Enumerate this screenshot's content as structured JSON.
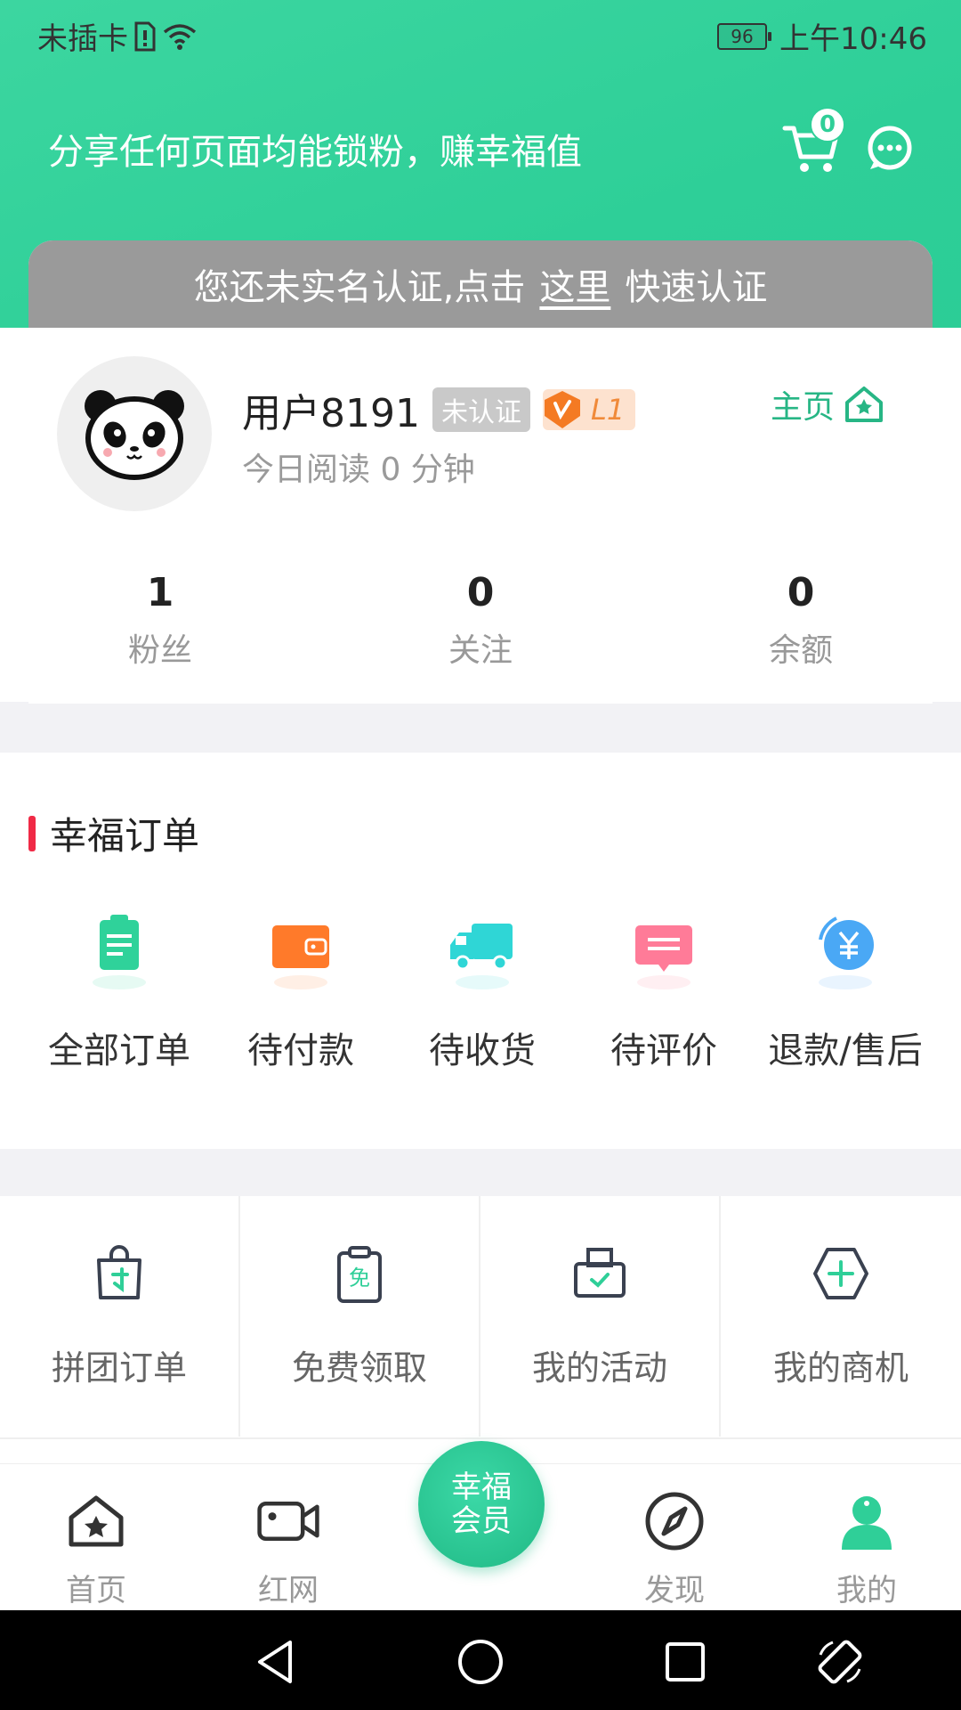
{
  "status_bar": {
    "carrier": "未插卡",
    "battery": "96",
    "time": "上午10:46"
  },
  "header": {
    "slogan": "分享任何页面均能锁粉，赚幸福值",
    "cart_count": "0"
  },
  "verify_banner": {
    "prefix": "您还未实名认证,点击",
    "link": "这里",
    "suffix": "快速认证"
  },
  "profile": {
    "username": "用户8191",
    "cert_tag": "未认证",
    "level": "L1",
    "read_time": "今日阅读 0 分钟",
    "home_link": "主页"
  },
  "stats": [
    {
      "value": "1",
      "label": "粉丝"
    },
    {
      "value": "0",
      "label": "关注"
    },
    {
      "value": "0",
      "label": "余额"
    }
  ],
  "orders": {
    "title": "幸福订单",
    "items": [
      {
        "label": "全部订单",
        "icon": "clipboard-icon",
        "color": "#2fd29a"
      },
      {
        "label": "待付款",
        "icon": "wallet-icon",
        "color": "#ff7a2a"
      },
      {
        "label": "待收货",
        "icon": "truck-icon",
        "color": "#2fd6d6"
      },
      {
        "label": "待评价",
        "icon": "comment-icon",
        "color": "#ff7b98"
      },
      {
        "label": "退款/售后",
        "icon": "refund-yen-icon",
        "color": "#4aa8f5"
      }
    ]
  },
  "tools": [
    {
      "label": "拼团订单",
      "icon": "group-bag-icon"
    },
    {
      "label": "免费领取",
      "icon": "free-clipboard-icon"
    },
    {
      "label": "我的活动",
      "icon": "activity-printer-icon"
    },
    {
      "label": "我的商机",
      "icon": "add-hexagon-icon"
    }
  ],
  "tabbar": {
    "home": "首页",
    "video": "红网",
    "vip_line1": "幸福",
    "vip_line2": "会员",
    "discover": "发现",
    "mine": "我的"
  },
  "colors": {
    "brand": "#2ecf98",
    "accent": "#f02a46",
    "verify_bg": "#9a9a9a"
  }
}
